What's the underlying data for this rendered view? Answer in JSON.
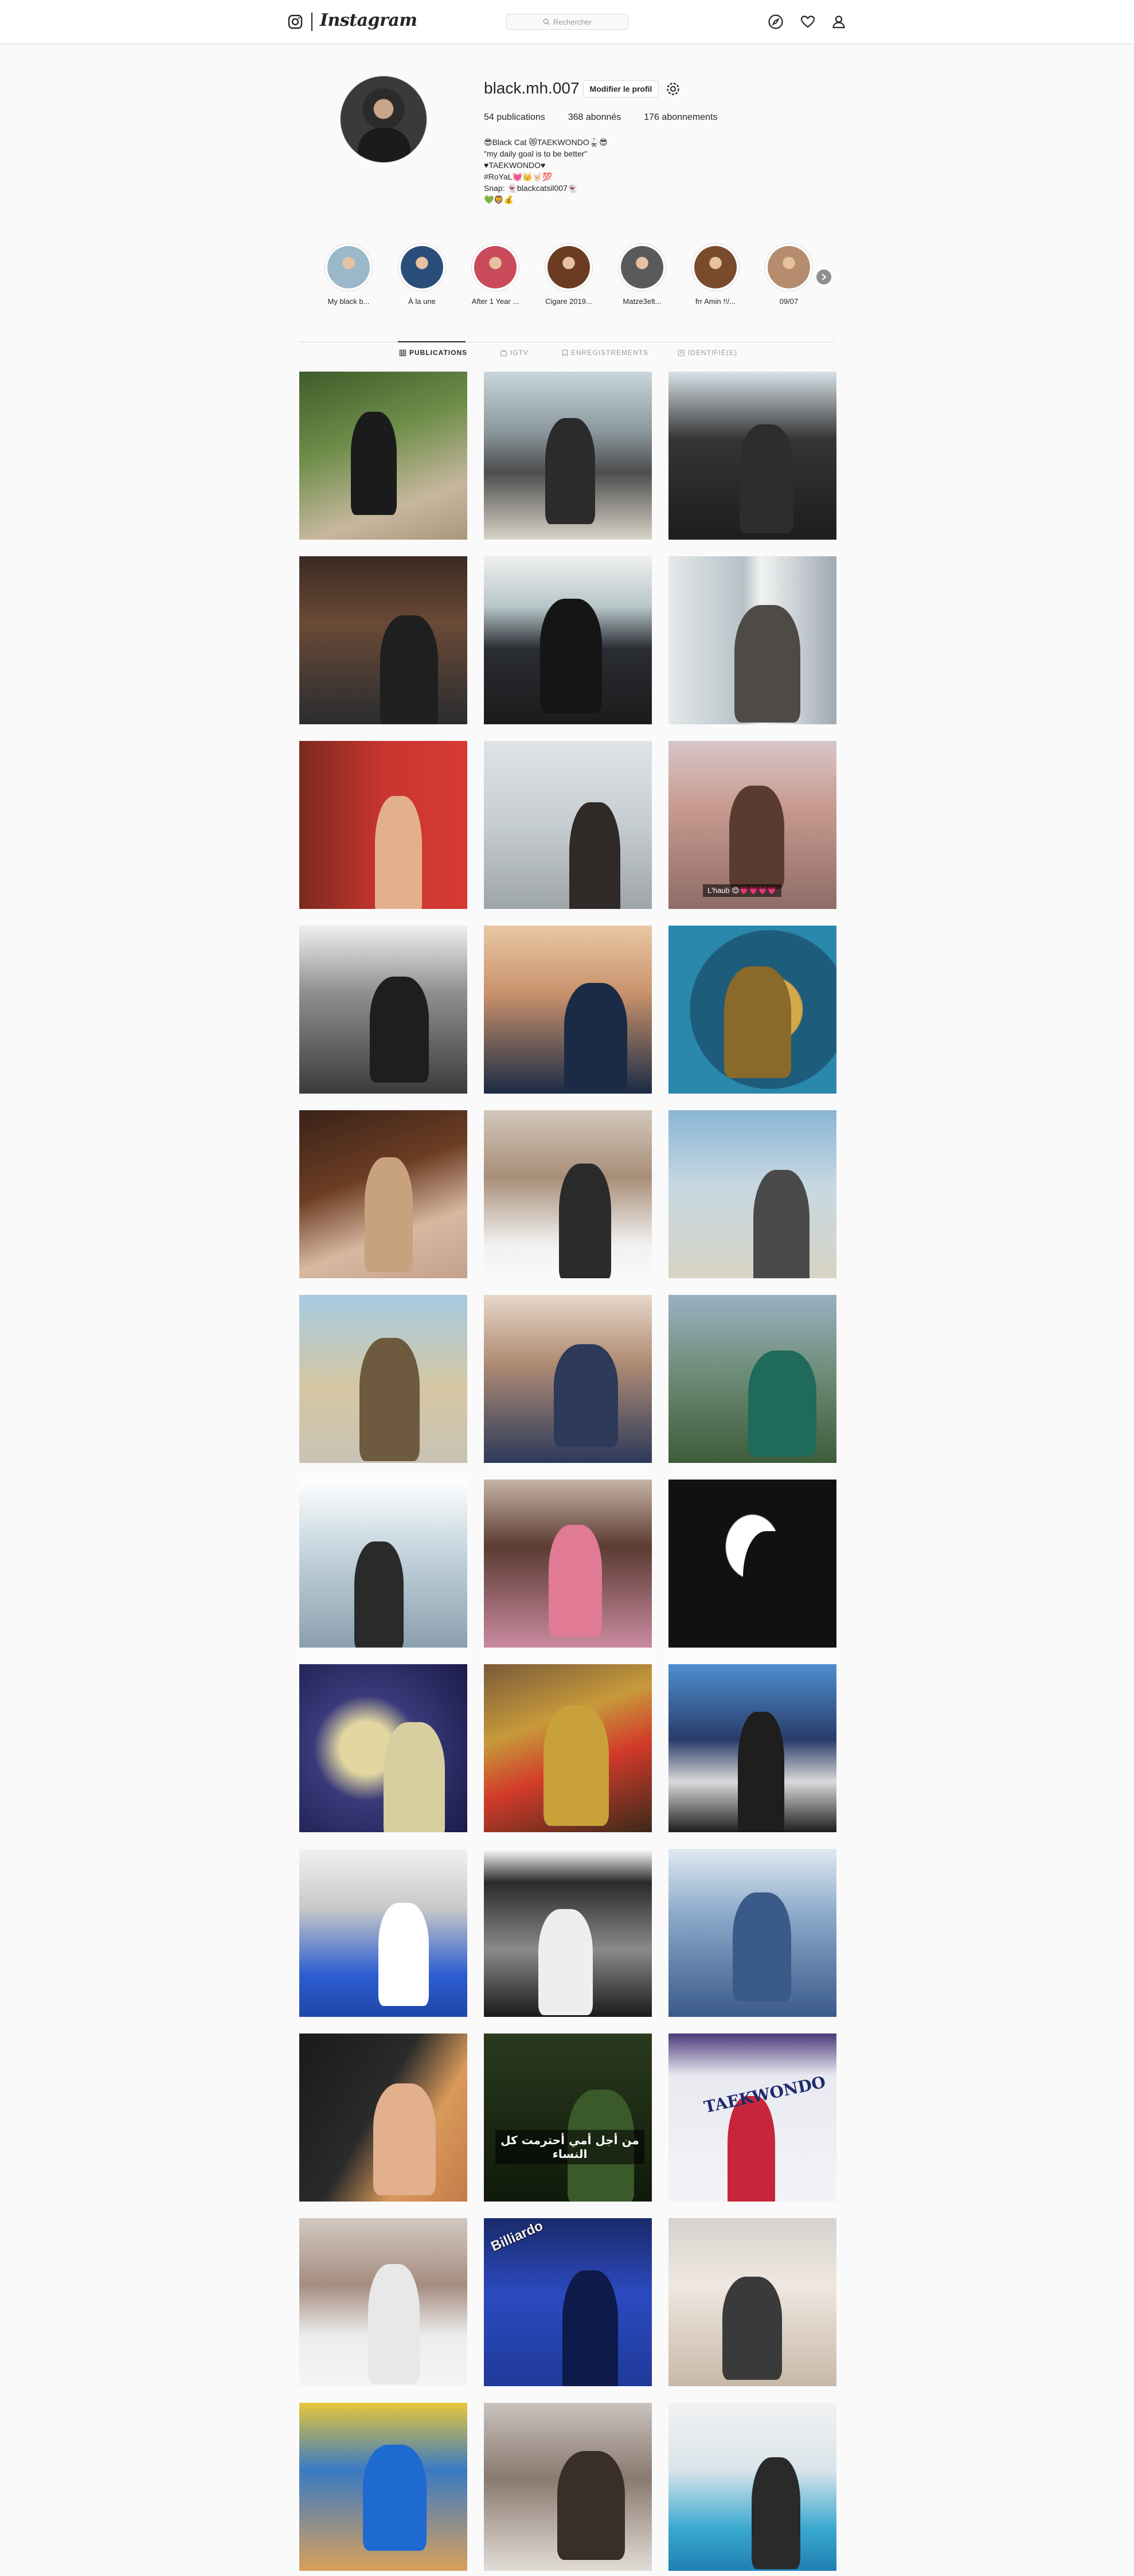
{
  "nav": {
    "brand": "Instagram",
    "search_placeholder": "Rechercher"
  },
  "profile": {
    "username": "black.mh.007",
    "edit_button": "Modifier le profil",
    "stats": {
      "posts": "54 publications",
      "followers": "368 abonnés",
      "following": "176 abonnements"
    },
    "bio": [
      "😎Black Cat 😻TAEKWONDO🥋😎",
      "\"my daily goal is to be better\"",
      "♥TAEKWONDO♥",
      "#RoYaL💓👑🤘🏻💯",
      "Snap: 👻blackcatsil007👻",
      "💚🦁💰"
    ]
  },
  "highlights": [
    {
      "label": "My black b...",
      "color": "#9bb8c9"
    },
    {
      "label": "À la une",
      "color": "#2a4d7a"
    },
    {
      "label": "After 1 Year ...",
      "color": "#c94b5b"
    },
    {
      "label": "Cigare 2019...",
      "color": "#6b3c22"
    },
    {
      "label": "Matze3elt...",
      "color": "#5a5a5a"
    },
    {
      "label": "frr Amin !!/...",
      "color": "#7a4a2c"
    },
    {
      "label": "09/07",
      "color": "#b58d6e"
    }
  ],
  "tabs": [
    {
      "label": "PUBLICATIONS",
      "icon": "grid-icon",
      "active": true
    },
    {
      "label": "IGTV",
      "icon": "igtv-icon",
      "active": false
    },
    {
      "label": "ENREGISTREMENTS",
      "icon": "bookmark-icon",
      "active": false
    },
    {
      "label": "IDENTIFIÉ(E)",
      "icon": "tag-icon",
      "active": false
    }
  ],
  "posts": [
    {
      "bg": "linear-gradient(160deg,#3e5c2a 0%,#6f8e4a 40%,#c7b79e 75%,#a9967d 100%)",
      "fig": "#1b1b1b"
    },
    {
      "bg": "linear-gradient(180deg,#c8d6dc 0%,#8c9aa0 35%,#4d4d4d 60%,#d9d4c8 100%)",
      "fig": "#2b2b2b"
    },
    {
      "bg": "linear-gradient(180deg,#d9e3ea 0%,#353535 40%,#1d1d1d 100%)",
      "fig": "#2d2d2d"
    },
    {
      "bg": "linear-gradient(180deg,#3b2a22 0%,#6a4a36 40%,#2a2c30 100%)",
      "fig": "#1f1f1f"
    },
    {
      "bg": "linear-gradient(180deg,#efefef 0%,#b7c6c9 30%,#2a2d33 55%,#1b1b1b 100%)",
      "fig": "#151515"
    },
    {
      "bg": "linear-gradient(90deg,#e5e8ea 0%,#b6c2c7 45%,#f2f2f2 55%,#9eaab3 100%)",
      "fig": "#4e4a46"
    },
    {
      "bg": "linear-gradient(90deg,#7a2a1f 0%,#c9352f 50%,#d63a33 100%)",
      "fig": "#e3b08e"
    },
    {
      "bg": "linear-gradient(180deg,#dfe4e6 0%,#c6cdd0 50%,#9ea5a8 100%)",
      "fig": "#2f2a28"
    },
    {
      "bg": "linear-gradient(180deg,#d9c6c9 0%,#c79a8f 40%,#8f6c67 100%)",
      "fig": "#5a3b32",
      "caption": "L'haub 😍💗💗💗💗"
    },
    {
      "bg": "linear-gradient(180deg,#efefef 0%,#8f8f8f 40%,#3b3b3b 100%)",
      "fig": "#1e1e1e"
    },
    {
      "bg": "linear-gradient(180deg,#e9c8a4 0%,#c9926c 40%,#1b2a45 100%)",
      "fig": "#1b2a45"
    },
    {
      "bg": "radial-gradient(circle at 60% 50%,#d4a74a 0 25%,#1d5c7a 26% 60%,#2a88ad 61% 100%)",
      "fig": "#8a6a2a"
    },
    {
      "bg": "linear-gradient(160deg,#3a2218 0%,#6c3d24 40%,#d8b8a0 70%,#c4a08e 100%)",
      "fig": "#c8a17f"
    },
    {
      "bg": "linear-gradient(180deg,#d2c7bb 0%,#a88e78 40%,#f1f1f1 80%,#fafafa 100%)",
      "fig": "#2b2b2b"
    },
    {
      "bg": "linear-gradient(180deg,#8ab5d5 0%,#c7d8e2 45%,#d8d4c4 100%)",
      "fig": "#4a4a4a"
    },
    {
      "bg": "linear-gradient(180deg,#a6cbe1 0%,#d5c7a3 55%,#c9c2b5 100%)",
      "fig": "#6e5a3e"
    },
    {
      "bg": "linear-gradient(180deg,#e7d7c9 0%,#b08c74 40%,#2d3a5a 100%)",
      "fig": "#2d3a5a"
    },
    {
      "bg": "linear-gradient(180deg,#9bb0c2 0%,#6f8e7a 45%,#3d5c3a 100%)",
      "fig": "#1f6a5a"
    },
    {
      "bg": "linear-gradient(180deg,#ffffff 0%,#c8d7e0 40%,#8aa0ad 100%)",
      "fig": "#2a2a2a"
    },
    {
      "bg": "linear-gradient(180deg,#c7b3a6 0%,#5b3b32 40%,#c98aa0 100%)",
      "fig": "#e07a95"
    },
    {
      "bg": "radial-gradient(ellipse at 50% 40%,#ffffff 0 22%,#111111 23% 100%)",
      "fig": "#111111"
    },
    {
      "bg": "radial-gradient(circle at 40% 50%,#e2d7a0 0 20%,#3a3a7a 40%,#1a1a4a 100%)",
      "fig": "#d8cfa0"
    },
    {
      "bg": "linear-gradient(160deg,#7a5a3a 0%,#c79a3a 35%,#d23a2a 60%,#3a2a1a 100%)",
      "fig": "#c8a13a"
    },
    {
      "bg": "linear-gradient(180deg,#4f8ed0 0%,#2a3c6a 45%,#d9d9d9 70%,#1e1e1e 100%)",
      "fig": "#1e1e1e"
    },
    {
      "bg": "linear-gradient(180deg,#f1f1f1 0%,#c9c9c9 35%,#2d5ed1 75%,#1f46a8 100%)",
      "fig": "#ffffff"
    },
    {
      "bg": "linear-gradient(180deg,#ffffff 0%,#2a2a2a 20%,#8a8a8a 60%,#1a1a1a 100%)",
      "fig": "#eeeeee"
    },
    {
      "bg": "linear-gradient(180deg,#dfe9f1 0%,#8aa8c9 40%,#3a5a8a 100%)",
      "fig": "#3a5a8a"
    },
    {
      "bg": "linear-gradient(120deg,#1a1a1a 0%,#2a2a2a 45%,#d99a5a 70%,#c47a4a 100%)",
      "fig": "#e3b08e"
    },
    {
      "bg": "linear-gradient(180deg,#2a3a1f 0%,#1c2a14 50%,#0f1a0a 100%)",
      "fig": "#3a5a2a",
      "arabic": "من أجل أمي أحترمت كل النساء"
    },
    {
      "bg": "linear-gradient(180deg,#4b3a7a 0%,#e9e9f1 25%,#f3f3f7 100%)",
      "fig": "#c7263a",
      "tkd": "TAEKWONDO"
    },
    {
      "bg": "linear-gradient(180deg,#d2c9c1 0%,#a58c80 40%,#ededed 70%,#f5f5f5 100%)",
      "fig": "#e8e8e8"
    },
    {
      "bg": "linear-gradient(180deg,#1a2a6a 0%,#2c4ac0 45%,#1f3a9a 100%)",
      "fig": "#0d1a4a",
      "billiard": "Billiardo"
    },
    {
      "bg": "linear-gradient(180deg,#d7d2ce 0%,#efe7e0 40%,#c8b8a8 100%)",
      "fig": "#3a3a3a"
    },
    {
      "bg": "linear-gradient(180deg,#e8c63a 0%,#3a7ac4 40%,#d9a05a 100%)",
      "fig": "#1e6ad0"
    },
    {
      "bg": "linear-gradient(180deg,#c9c2bd 0%,#8a7a70 45%,#e2dcd6 100%)",
      "fig": "#3a2e28"
    },
    {
      "bg": "linear-gradient(180deg,#f2f2f2 0%,#d9e4ea 40%,#39a9d0 75%,#1f7fb2 100%)",
      "fig": "#2a2a2a"
    }
  ]
}
